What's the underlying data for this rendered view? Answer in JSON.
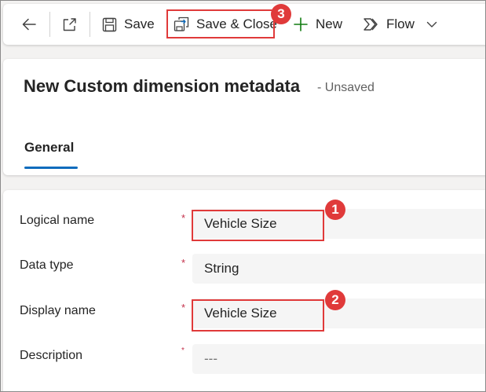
{
  "toolbar": {
    "back_icon": "back-arrow-icon",
    "popout_icon": "open-in-new-window-icon",
    "save_label": "Save",
    "save_close_label": "Save & Close",
    "new_label": "New",
    "flow_label": "Flow"
  },
  "header": {
    "title": "New Custom dimension metadata",
    "status": "- Unsaved",
    "tabs": [
      {
        "label": "General",
        "selected": true
      }
    ]
  },
  "form": {
    "fields": [
      {
        "label": "Logical name",
        "required": "*",
        "value": "Vehicle Size"
      },
      {
        "label": "Data type",
        "required": "*",
        "value": "String"
      },
      {
        "label": "Display name",
        "required": "*",
        "value": "Vehicle Size"
      },
      {
        "label": "Description",
        "required": "*",
        "value": "---"
      }
    ]
  },
  "callouts": [
    {
      "number": "1"
    },
    {
      "number": "2"
    },
    {
      "number": "3"
    }
  ],
  "colors": {
    "accent": "#0f6cbd",
    "new_icon": "#107c10",
    "highlight": "#e03a3a",
    "required": "#c4314b",
    "field_bg": "#f5f5f5",
    "page_bg": "#f3f2f1"
  }
}
